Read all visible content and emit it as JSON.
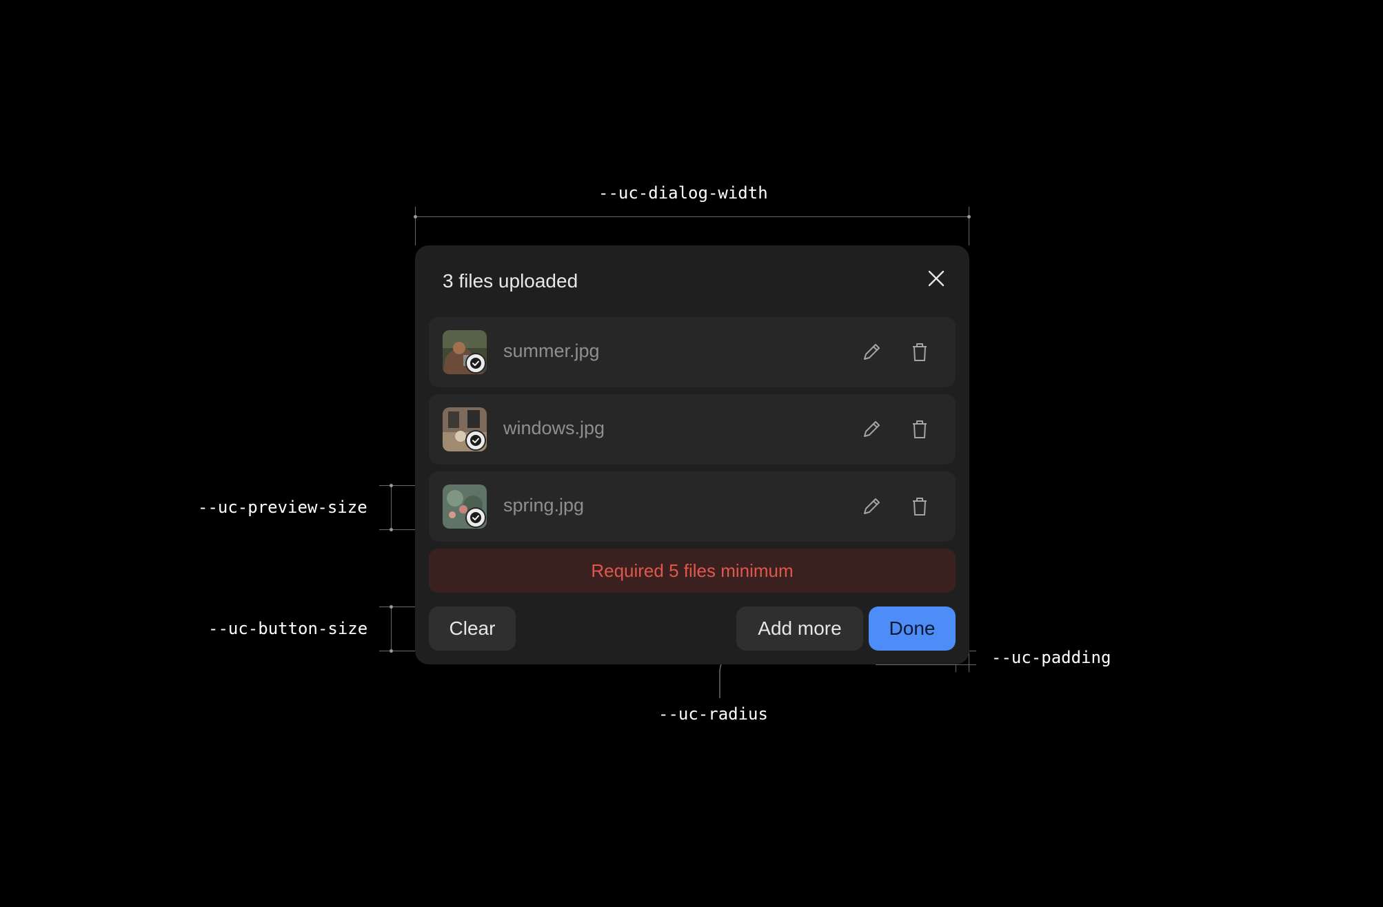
{
  "dialog": {
    "title": "3 files uploaded",
    "close_icon": "close-icon",
    "files": [
      {
        "name": "summer.jpg",
        "status": "uploaded"
      },
      {
        "name": "windows.jpg",
        "status": "uploaded"
      },
      {
        "name": "spring.jpg",
        "status": "uploaded"
      }
    ],
    "error_message": "Required 5 files minimum",
    "buttons": {
      "clear": "Clear",
      "add_more": "Add more",
      "done": "Done"
    }
  },
  "annotations": {
    "dialog_width": "--uc-dialog-width",
    "preview_size": "--uc-preview-size",
    "button_size": "--uc-button-size",
    "radius": "--uc-radius",
    "padding": "--uc-padding"
  },
  "colors": {
    "background": "#000000",
    "dialog": "#1f1f1f",
    "row": "#272727",
    "error_bg": "#3a2120",
    "error_text": "#e2574c",
    "primary": "#4e8cf7"
  }
}
